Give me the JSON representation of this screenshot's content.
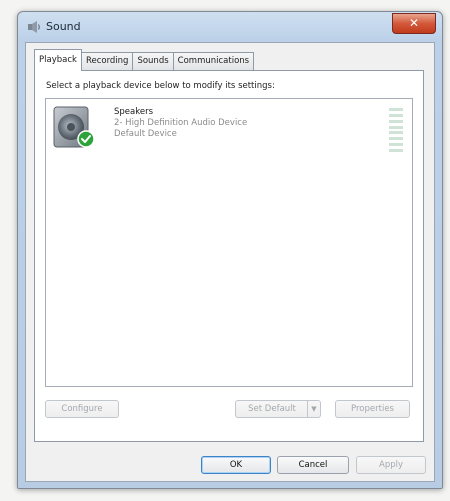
{
  "window": {
    "title": "Sound",
    "close_label": "✕"
  },
  "tabs": [
    {
      "label": "Playback",
      "active": true
    },
    {
      "label": "Recording",
      "active": false
    },
    {
      "label": "Sounds",
      "active": false
    },
    {
      "label": "Communications",
      "active": false
    }
  ],
  "playback": {
    "instruction": "Select a playback device below to modify its settings:",
    "devices": [
      {
        "name": "Speakers",
        "description": "2- High Definition Audio Device",
        "status": "Default Device",
        "icon": "speaker-icon",
        "status_icon": "green-checkmark-icon"
      }
    ],
    "buttons": {
      "configure": "Configure",
      "set_default": "Set Default",
      "set_default_arrow": "▼",
      "properties": "Properties"
    }
  },
  "dialog_buttons": {
    "ok": "OK",
    "cancel": "Cancel",
    "apply": "Apply"
  },
  "colors": {
    "titlebar": "#bcd1e8",
    "close_button": "#c13a1d",
    "default_check": "#2fa33b",
    "level_meter": "#cfe3d6"
  }
}
